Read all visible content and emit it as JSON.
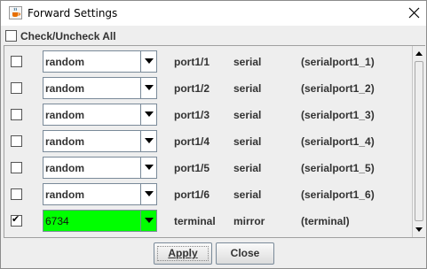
{
  "window": {
    "title": "Forward Settings",
    "app_icon": "java-cup-icon",
    "close_icon": "close-icon"
  },
  "check_all": {
    "label": "Check/Uncheck All",
    "checked": false
  },
  "rows": [
    {
      "checked": false,
      "value": "random",
      "port": "port1/1",
      "type": "serial",
      "name": "(serialport1_1)",
      "highlight": false
    },
    {
      "checked": false,
      "value": "random",
      "port": "port1/2",
      "type": "serial",
      "name": "(serialport1_2)",
      "highlight": false
    },
    {
      "checked": false,
      "value": "random",
      "port": "port1/3",
      "type": "serial",
      "name": "(serialport1_3)",
      "highlight": false
    },
    {
      "checked": false,
      "value": "random",
      "port": "port1/4",
      "type": "serial",
      "name": "(serialport1_4)",
      "highlight": false
    },
    {
      "checked": false,
      "value": "random",
      "port": "port1/5",
      "type": "serial",
      "name": "(serialport1_5)",
      "highlight": false
    },
    {
      "checked": false,
      "value": "random",
      "port": "port1/6",
      "type": "serial",
      "name": "(serialport1_6)",
      "highlight": false
    },
    {
      "checked": true,
      "value": "6734",
      "port": "terminal",
      "type": "mirror",
      "name": "(terminal)",
      "highlight": true
    }
  ],
  "buttons": {
    "apply_label": "Apply",
    "close_label": "Close"
  },
  "colors": {
    "highlight": "#00ff00",
    "text": "#333333"
  }
}
